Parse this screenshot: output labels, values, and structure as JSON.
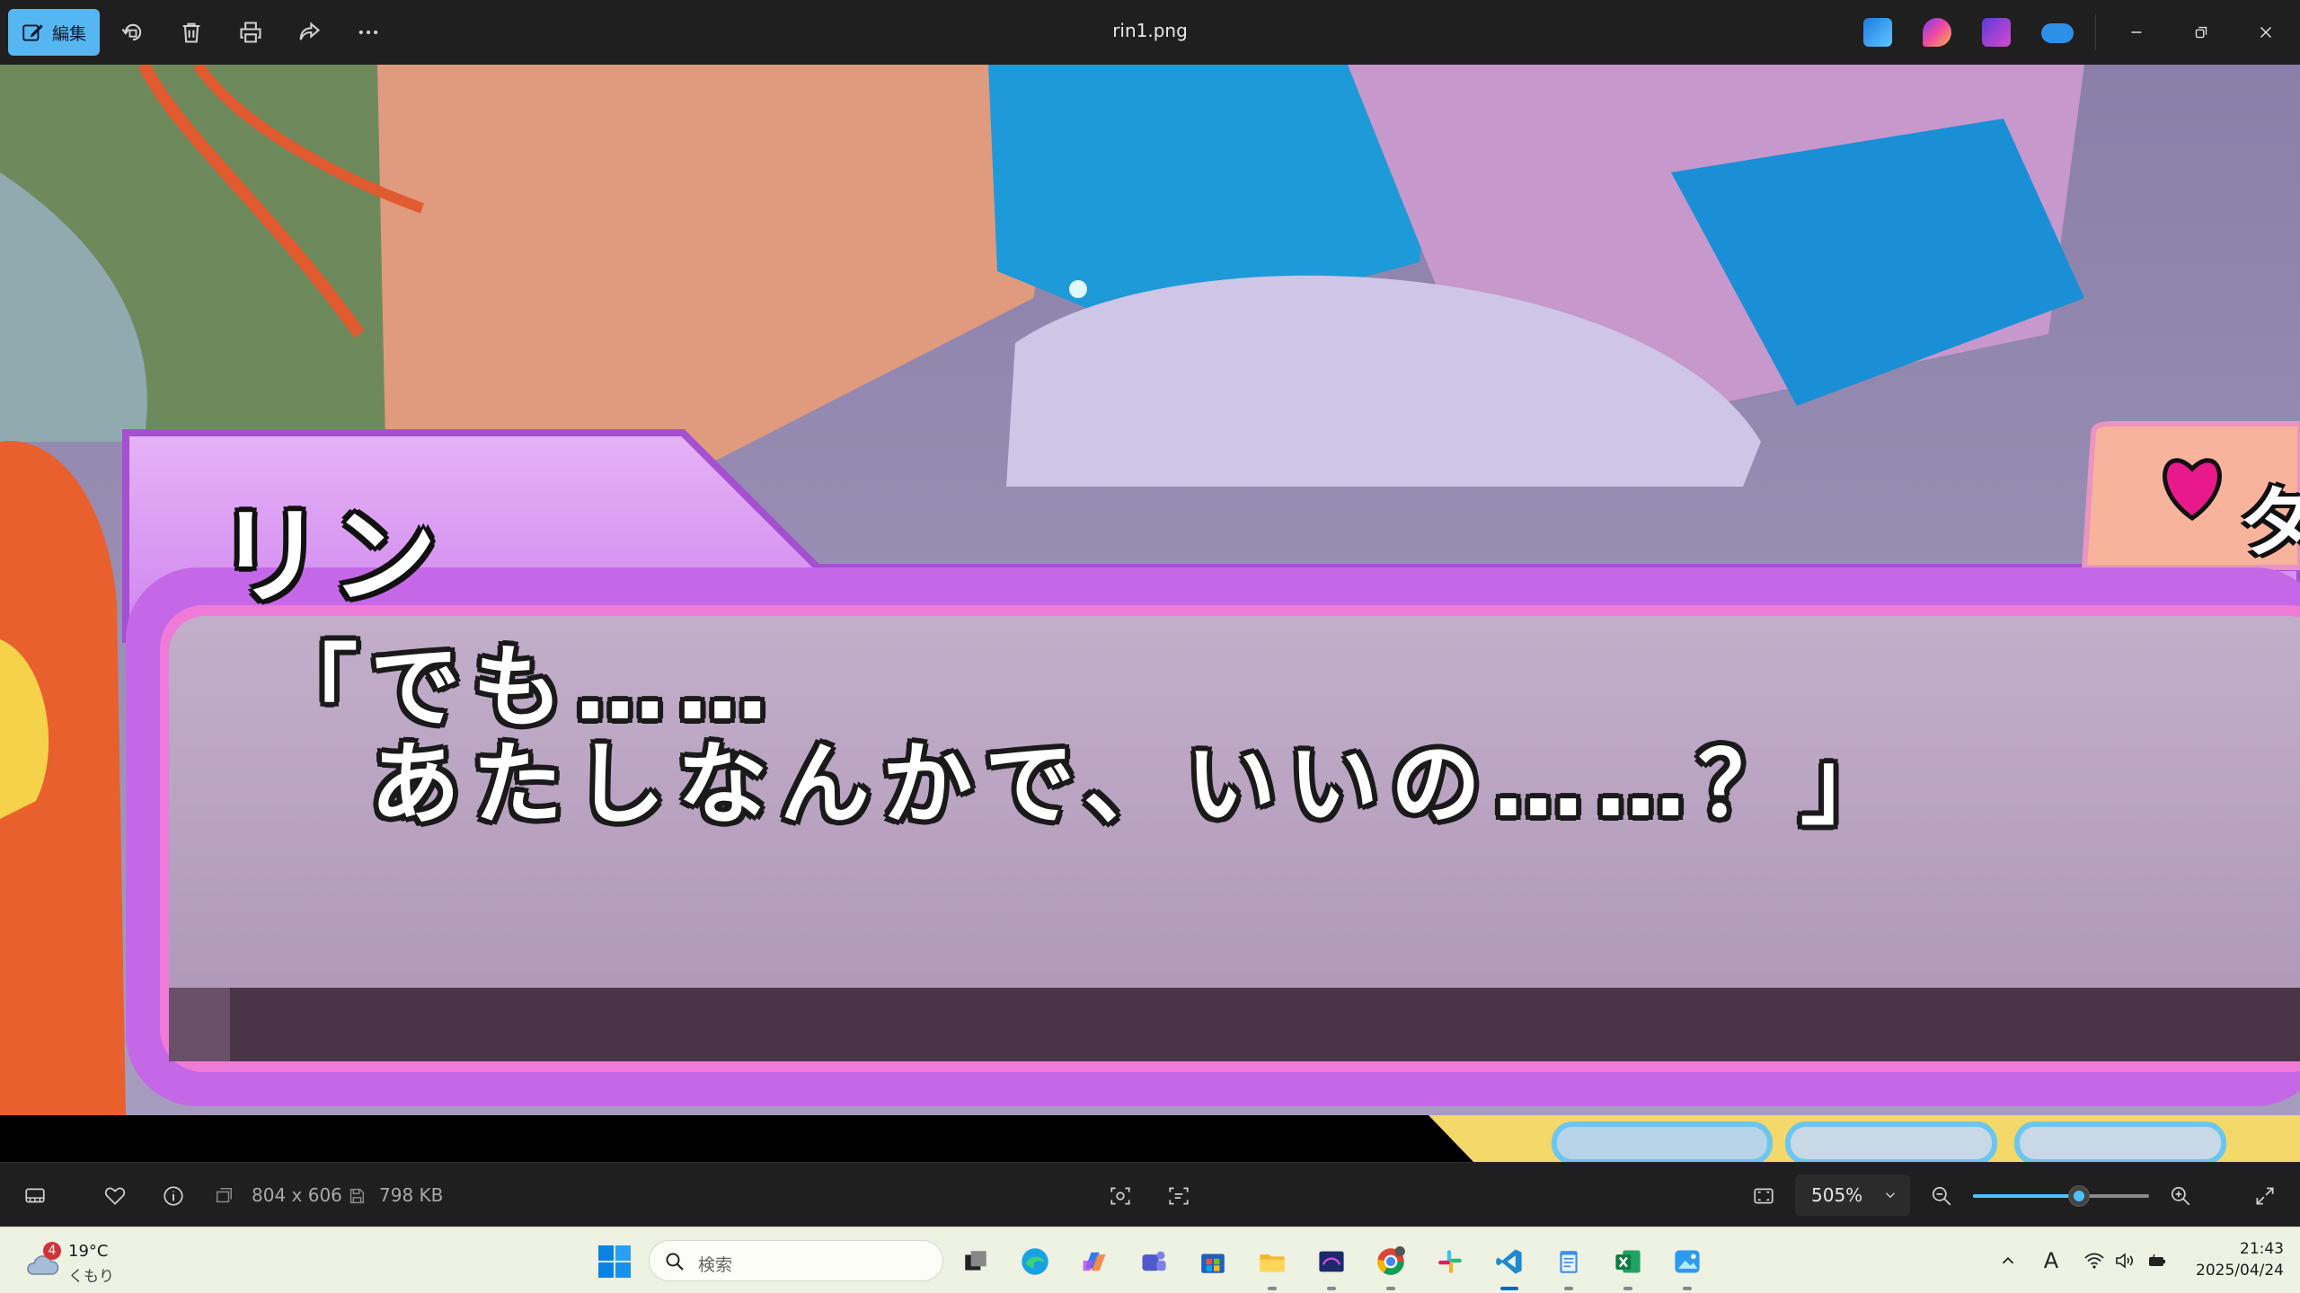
{
  "titlebar": {
    "edit_label": "編集",
    "file_name": "rin1.png"
  },
  "image": {
    "speaker_name": "リン",
    "dialogue": "「でも……\n　あたしなんかで、いいの……？」",
    "side_label": "タ"
  },
  "infobar": {
    "dimensions": "804 x 606",
    "file_size": "798 KB",
    "zoom": "505%",
    "zoom_level": 0.6
  },
  "taskbar": {
    "weather_badge": "4",
    "weather_temp": "19°C",
    "weather_condition": "くもり",
    "search_placeholder": "検索",
    "ime_indicator": "A",
    "time": "21:43",
    "date": "2025/04/24"
  },
  "colors": {
    "accent": "#56b6f2",
    "slider": "#4cc2ff",
    "dialog_frame": "#c468e8",
    "dialog_border": "#f07ad8"
  }
}
